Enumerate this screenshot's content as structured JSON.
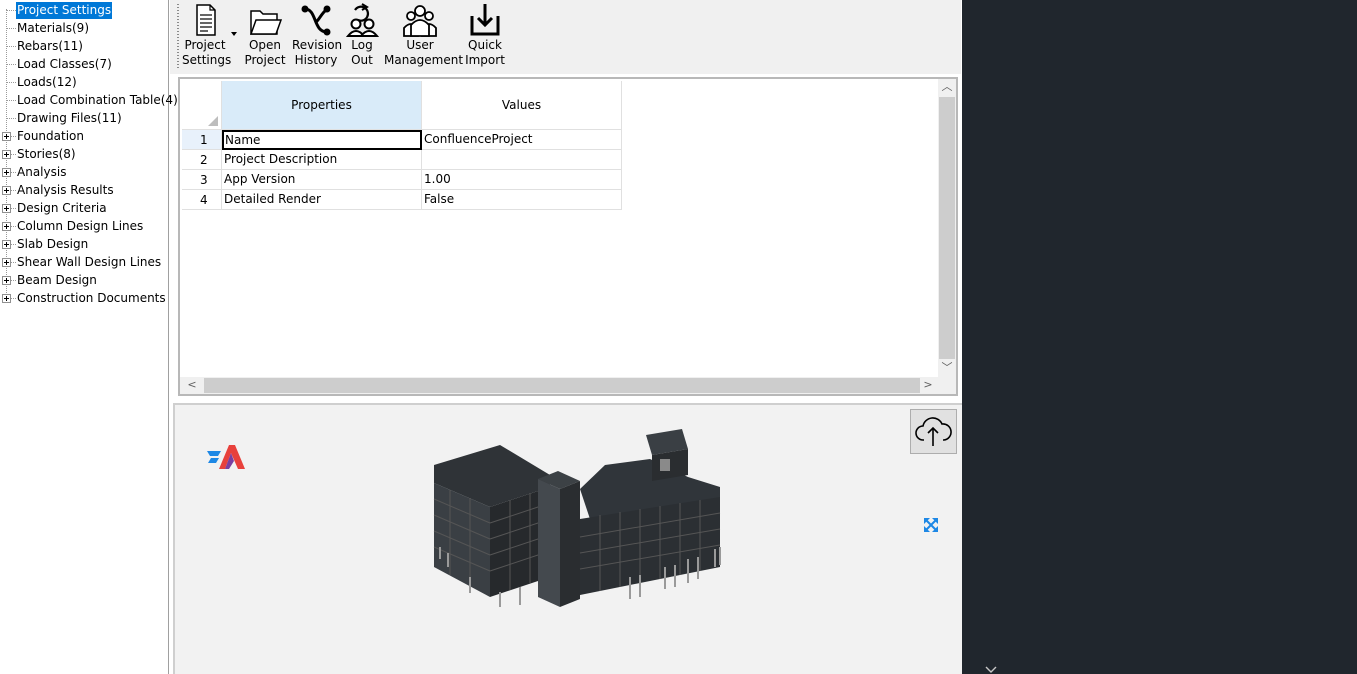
{
  "tree": {
    "items": [
      {
        "label": "Project Settings",
        "expandable": false,
        "selected": true
      },
      {
        "label": "Materials(9)",
        "expandable": false
      },
      {
        "label": "Rebars(11)",
        "expandable": false
      },
      {
        "label": "Load Classes(7)",
        "expandable": false
      },
      {
        "label": "Loads(12)",
        "expandable": false
      },
      {
        "label": "Load Combination Table(4)",
        "expandable": false
      },
      {
        "label": "Drawing Files(11)",
        "expandable": false
      },
      {
        "label": "Foundation",
        "expandable": true
      },
      {
        "label": "Stories(8)",
        "expandable": true
      },
      {
        "label": "Analysis",
        "expandable": true
      },
      {
        "label": "Analysis Results",
        "expandable": true
      },
      {
        "label": "Design Criteria",
        "expandable": true
      },
      {
        "label": "Column Design Lines",
        "expandable": true
      },
      {
        "label": "Slab Design",
        "expandable": true
      },
      {
        "label": "Shear Wall Design Lines",
        "expandable": true
      },
      {
        "label": "Beam Design",
        "expandable": true
      },
      {
        "label": "Construction Documents",
        "expandable": true
      }
    ]
  },
  "toolbar": {
    "project_settings": {
      "line1": "Project",
      "line2": "Settings"
    },
    "open_project": {
      "line1": "Open",
      "line2": "Project"
    },
    "revision_history": {
      "line1": "Revision",
      "line2": "History"
    },
    "log_out": {
      "line1": "Log",
      "line2": "Out"
    },
    "user_management": {
      "line1": "User",
      "line2": "Management"
    },
    "quick_import": {
      "line1": "Quick",
      "line2": "Import"
    }
  },
  "grid": {
    "headers": {
      "properties": "Properties",
      "values": "Values"
    },
    "rows": [
      {
        "num": "1",
        "property": "Name",
        "value": "ConfluenceProject"
      },
      {
        "num": "2",
        "property": "Project Description",
        "value": ""
      },
      {
        "num": "3",
        "property": "App Version",
        "value": "1.00"
      },
      {
        "num": "4",
        "property": "Detailed Render",
        "value": "False"
      }
    ]
  },
  "colors": {
    "selection": "#0078d7",
    "header_highlight": "#d9ebf9",
    "dark_panel": "#20262d",
    "toolbar_bg": "#f0f0f0",
    "viewer_bg": "#f2f2f2",
    "expand_icon": "#1e88e5"
  },
  "icons": {
    "project_settings": "document-settings-icon",
    "open_project": "folder-open-icon",
    "revision_history": "branch-history-icon",
    "log_out": "user-logout-icon",
    "user_management": "users-group-icon",
    "quick_import": "download-tray-icon",
    "upload": "cloud-upload-icon",
    "expand": "expand-arrows-icon"
  }
}
